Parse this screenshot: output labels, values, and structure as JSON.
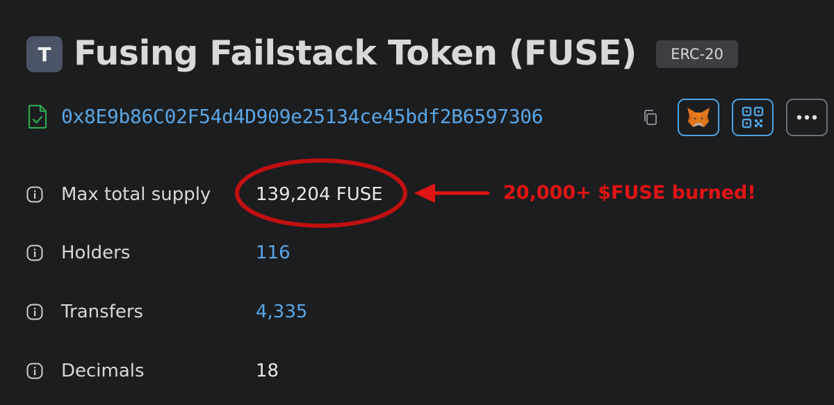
{
  "token": {
    "avatar_letter": "T",
    "title": "Fusing Failstack Token (FUSE)",
    "standard_badge": "ERC-20",
    "address": "0x8E9b86C02F54d4D909e25134ce45bdf2B6597306"
  },
  "icons": {
    "verified": "verified-contract-icon",
    "copy": "copy-icon",
    "metamask": "metamask-fox-icon",
    "qr": "qr-code-icon",
    "more": "more-dots-icon",
    "info": "info-icon"
  },
  "colors": {
    "background": "#1c1d1f",
    "link": "#5aa6e6",
    "annotation": "#e01414",
    "verified_green": "#2fa84f"
  },
  "details": [
    {
      "label": "Max total supply",
      "value": "139,204 FUSE"
    },
    {
      "label": "Holders",
      "value": "116"
    },
    {
      "label": "Transfers",
      "value": "4,335"
    },
    {
      "label": "Decimals",
      "value": "18"
    }
  ],
  "annotation": {
    "text": "20,000+ $FUSE burned!"
  }
}
